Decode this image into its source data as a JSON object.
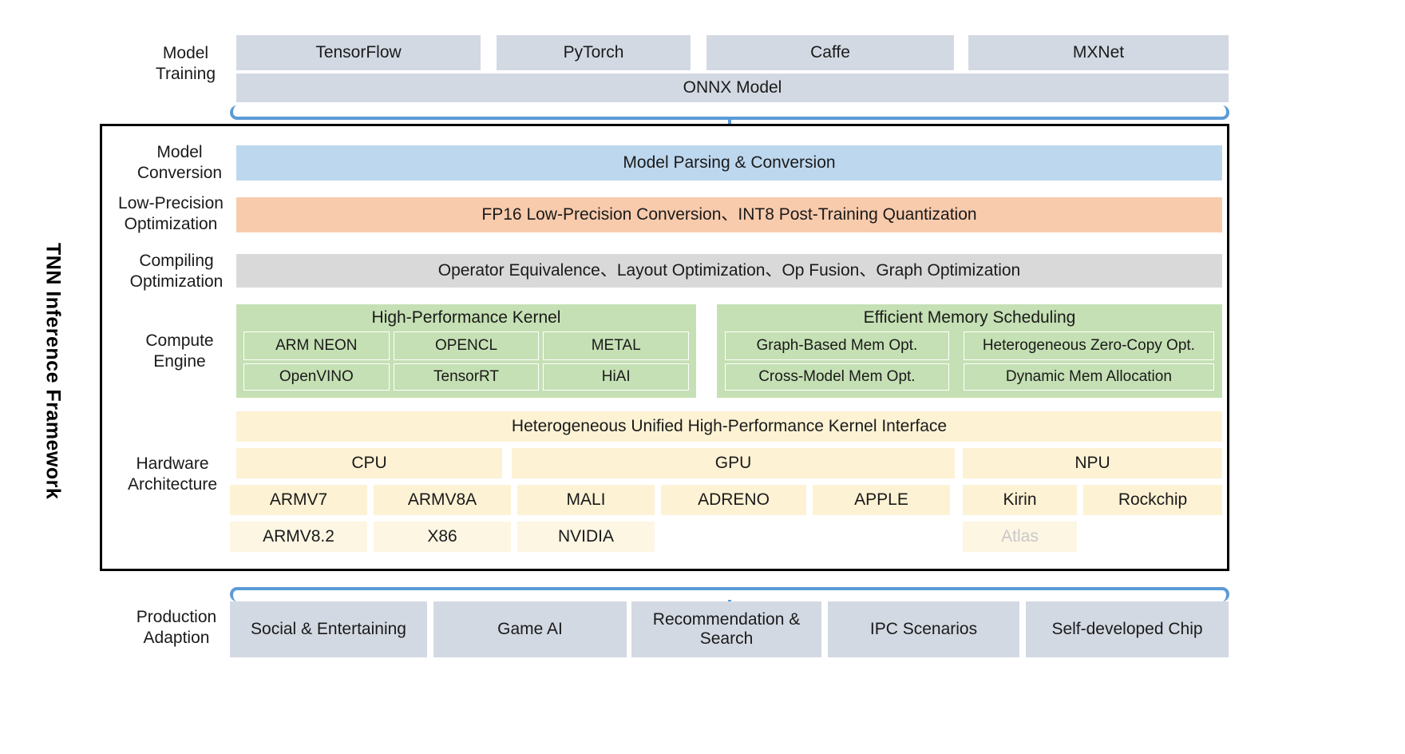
{
  "diagram": {
    "vertical_title": "TNN Inference Framework",
    "accent_color": "#5b9bd5",
    "border_color": "#000000"
  },
  "rows": {
    "model_training": {
      "label": "Model\nTraining",
      "label_line1": "Model",
      "label_line2": "Training",
      "frameworks": [
        {
          "name": "TensorFlow"
        },
        {
          "name": "PyTorch"
        },
        {
          "name": "Caffe"
        },
        {
          "name": "MXNet"
        }
      ],
      "onnx": "ONNX Model",
      "color": "#d3d9e3"
    },
    "model_conversion": {
      "label_line1": "Model",
      "label_line2": "Conversion",
      "bar": "Model Parsing & Conversion",
      "color": "#bdd7ee"
    },
    "low_precision": {
      "label_line1": "Low-Precision",
      "label_line2": "Optimization",
      "bar": "FP16 Low-Precision Conversion、INT8 Post-Training Quantization",
      "color": "#f8cbad"
    },
    "compiling": {
      "label_line1": "Compiling",
      "label_line2": "Optimization",
      "bar": "Operator Equivalence、Layout Optimization、Op Fusion、Graph Optimization",
      "color": "#d9d9d9"
    },
    "compute_engine": {
      "label_line1": "Compute",
      "label_line2": "Engine",
      "color": "#c5e0b4",
      "panels": [
        {
          "title": "High-Performance Kernel",
          "tiles_row1": [
            "ARM NEON",
            "OPENCL",
            "METAL"
          ],
          "tiles_row2": [
            "OpenVINO",
            "TensorRT",
            "HiAI"
          ]
        },
        {
          "title": "Efficient Memory Scheduling",
          "tiles_row1": [
            "Graph-Based Mem Opt.",
            "Heterogeneous Zero-Copy Opt."
          ],
          "tiles_row2": [
            "Cross-Model Mem Opt.",
            "Dynamic Mem Allocation"
          ]
        }
      ]
    },
    "hardware": {
      "label_line1": "Hardware",
      "label_line2": "Architecture",
      "color": "#fdf2d4",
      "interface_bar": "Heterogeneous Unified High-Performance Kernel Interface",
      "categories": [
        "CPU",
        "GPU",
        "NPU"
      ],
      "cpu_items_row1": [
        "ARMV7",
        "ARMV8A"
      ],
      "cpu_items_row2": [
        "ARMV8.2",
        "X86"
      ],
      "gpu_items_row1": [
        "MALI",
        "ADRENO",
        "APPLE"
      ],
      "gpu_items_row2": [
        "NVIDIA"
      ],
      "npu_items_row1": [
        "Kirin",
        "Rockchip"
      ],
      "npu_items_row2": [
        "Atlas"
      ],
      "faded_item": "Atlas"
    },
    "production": {
      "label_line1": "Production",
      "label_line2": "Adaption",
      "color": "#d3d9e3",
      "items": [
        "Social & Entertaining",
        "Game AI",
        "Recommendation & Search",
        "IPC Scenarios",
        "Self-developed Chip"
      ]
    }
  }
}
